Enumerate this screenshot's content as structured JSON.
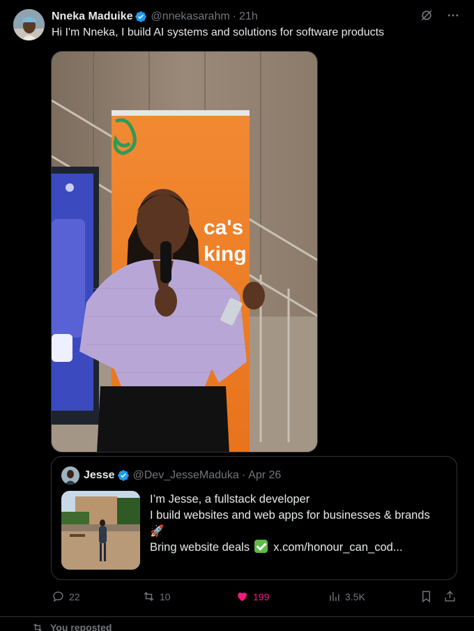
{
  "tweet": {
    "author_name": "Nneka Maduike",
    "handle": "@nnekasarahm",
    "separator": "·",
    "time": "21h",
    "text": "Hi I'm Nneka, I build AI systems and solutions for software products",
    "media_banner_text_1": "ca's",
    "media_banner_text_2": "king"
  },
  "quote": {
    "author_name": "Jesse",
    "handle": "@Dev_JesseMaduka",
    "separator": "·",
    "time": "Apr 26",
    "lines": [
      "I’m Jesse, a fullstack developer",
      "I build websites and web apps for businesses & brands",
      "🚀"
    ],
    "line4_text": "Bring website deals",
    "line4_link": "x.com/honour_can_cod..."
  },
  "actions": {
    "replies": "22",
    "reposts": "10",
    "likes": "199",
    "views": "3.5K"
  },
  "reposted_label": "You reposted",
  "colors": {
    "background": "#000000",
    "text": "#e7e9ea",
    "secondary": "#71767b",
    "border": "#2f3336",
    "like": "#f91880",
    "verified": "#1d9bf0"
  },
  "icons": [
    "verified-badge-icon",
    "grok-icon",
    "more-icon",
    "reply-icon",
    "repost-icon",
    "heart-icon",
    "views-icon",
    "bookmark-icon",
    "share-icon"
  ]
}
